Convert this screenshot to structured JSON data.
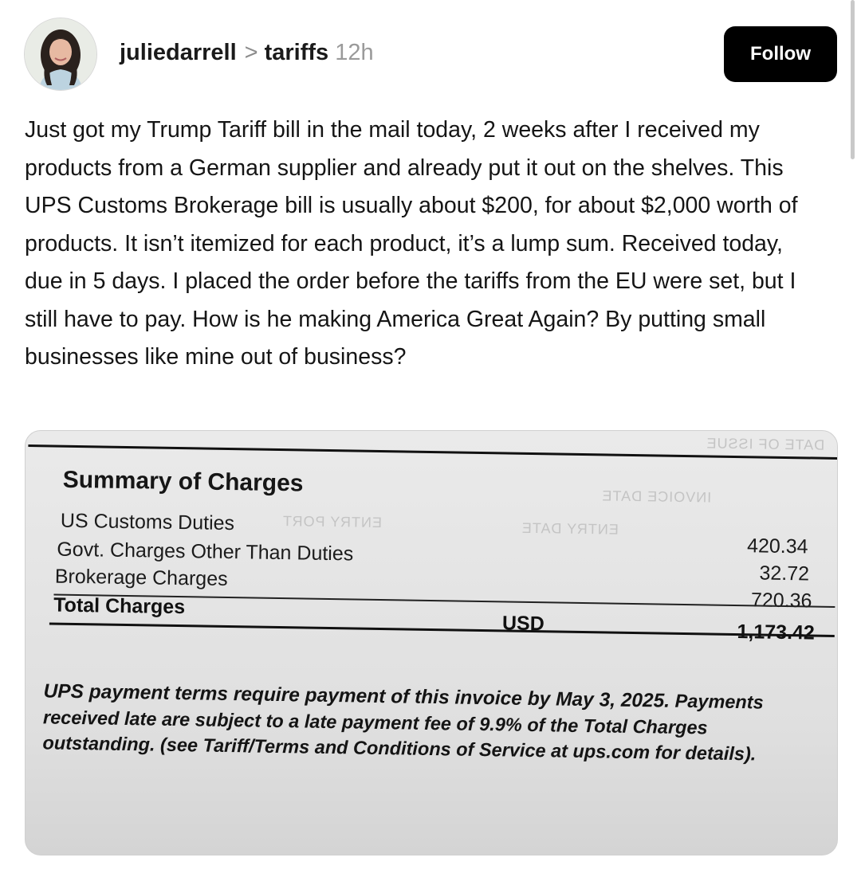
{
  "post": {
    "username": "juliedarrell",
    "separator": ">",
    "topic": "tariffs",
    "time_ago": "12h",
    "follow_label": "Follow",
    "body": "Just got my Trump Tariff bill in the mail today, 2 weeks after I received my products from a German supplier and already put it out on the shelves. This UPS Customs Brokerage bill is usually about $200, for about $2,000 worth of products. It isn’t itemized for each product, it’s a lump sum. Received today, due in 5 days. I placed the order before the tariffs from the EU were set, but I still have to pay. How is he making America Great Again? By putting small businesses like mine out of business?"
  },
  "invoice": {
    "title": "Summary of Charges",
    "charges": [
      {
        "label": "US Customs Duties",
        "amount": "420.34"
      },
      {
        "label": "Govt. Charges Other Than Duties",
        "amount": "32.72"
      },
      {
        "label": "Brokerage Charges",
        "amount": "720.36"
      }
    ],
    "total_label": "Total Charges",
    "currency": "USD",
    "total_amount": "1,173.42",
    "terms_line1": "UPS payment terms require payment of this invoice by May 3, 2025.",
    "terms_rest": "Payments received late are subject to a late payment fee of 9.9% of the Total Charges outstanding. (see Tariff/Terms and Conditions of Service at ups.com for details)."
  },
  "icons": {
    "avatar": "profile-photo",
    "chevron": "chevron-right-icon"
  },
  "colors": {
    "follow_button_bg": "#000000",
    "follow_button_text": "#ffffff",
    "timestamp": "#9a9a9a"
  }
}
